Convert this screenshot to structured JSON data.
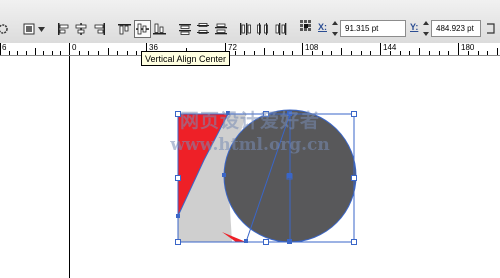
{
  "toolbar": {
    "tooltip": "Vertical Align Center",
    "x_label": "X:",
    "x_value": "91.315 pt",
    "y_label": "Y:",
    "y_value": "484.923 pt"
  },
  "ruler": {
    "labels": [
      "6",
      "0",
      "36",
      "72",
      "108",
      "144",
      "180"
    ]
  },
  "watermark": {
    "line1": "网页设计爱好者",
    "line2": "www.html.org.cn"
  },
  "colors": {
    "accent_red": "#ee2027",
    "light_gray": "#cfcfcf",
    "dark_gray": "#58585a",
    "selection_blue": "#3a66c8"
  }
}
